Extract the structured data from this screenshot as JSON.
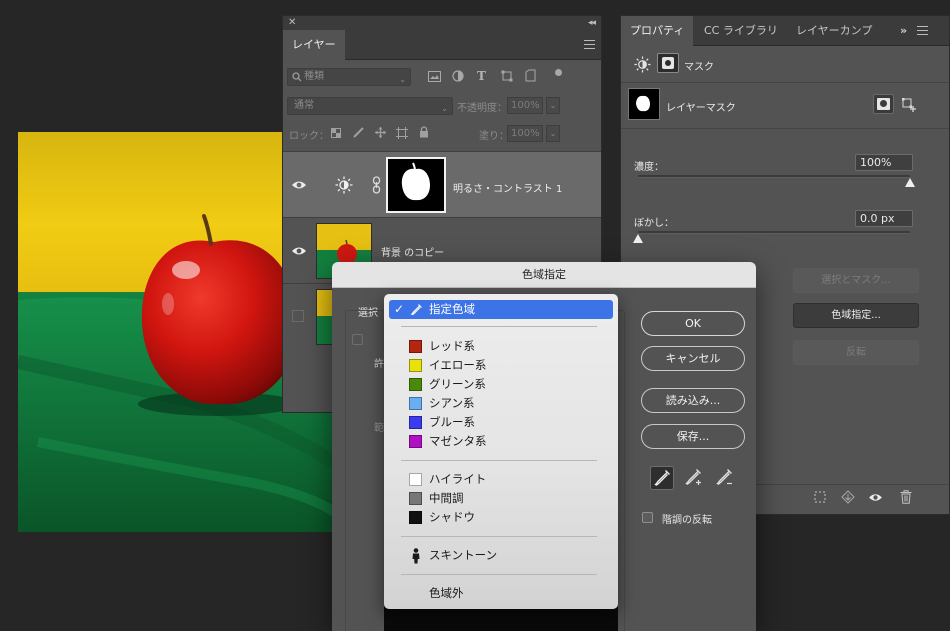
{
  "layers_panel": {
    "tab": "レイヤー",
    "filter_placeholder": "種類",
    "blend_mode": "通常",
    "opacity_label": "不透明度：",
    "opacity_value": "100%",
    "lock_label": "ロック：",
    "fill_label": "塗り：",
    "fill_value": "100%",
    "layers": [
      {
        "name": "明るさ・コントラスト 1",
        "visible": true
      },
      {
        "name": "背景 のコピー",
        "visible": true
      },
      {
        "name": "",
        "visible": false
      }
    ]
  },
  "properties_panel": {
    "tabs": [
      "プロパティ",
      "CC ライブラリ",
      "レイヤーカンプ"
    ],
    "mask_header": "マスク",
    "layer_mask_label": "レイヤーマスク",
    "density_label": "濃度：",
    "density_value": "100%",
    "density_fraction": 1.0,
    "feather_label": "ぼかし：",
    "feather_value": "0.0 px",
    "feather_fraction": 0.0,
    "buttons": {
      "select_and_mask": "選択とマスク...",
      "color_range": "色域指定...",
      "invert": "反転"
    }
  },
  "dialog": {
    "title": "色域指定",
    "select_label": "選択",
    "partial_labels": [
      "許",
      "範"
    ],
    "buttons": {
      "ok": "OK",
      "cancel": "キャンセル",
      "load": "読み込み...",
      "save": "保存..."
    },
    "invert_label": "階調の反転"
  },
  "dropdown": {
    "selected": "指定色域",
    "groups": [
      [
        {
          "label": "レッド系",
          "color": "#b3260f"
        },
        {
          "label": "イエロー系",
          "color": "#e8e20c"
        },
        {
          "label": "グリーン系",
          "color": "#4a8a0a"
        },
        {
          "label": "シアン系",
          "color": "#6aaef2"
        },
        {
          "label": "ブルー系",
          "color": "#3b3bf0"
        },
        {
          "label": "マゼンタ系",
          "color": "#b010c4"
        }
      ],
      [
        {
          "label": "ハイライト",
          "color": "#ffffff"
        },
        {
          "label": "中間調",
          "color": "#777777"
        },
        {
          "label": "シャドウ",
          "color": "#111111"
        }
      ]
    ],
    "skin_tones": "スキントーン",
    "out_of_gamut": "色域外"
  },
  "colors": {
    "menu_highlight": "#3c73e6",
    "panel_bg": "#535353",
    "app_bg": "#262626"
  }
}
